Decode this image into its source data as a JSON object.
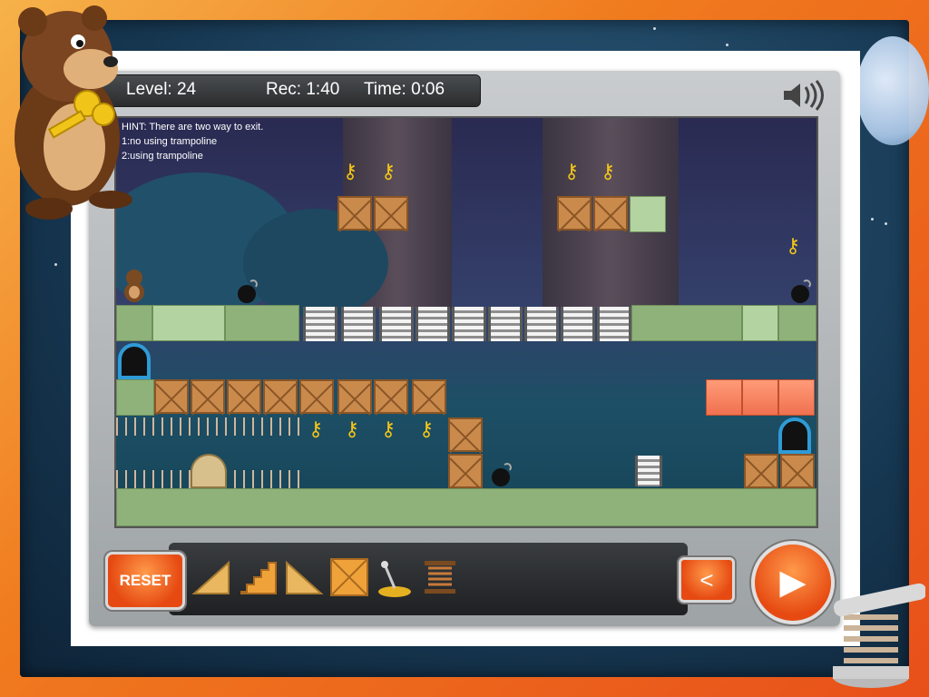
{
  "hud": {
    "level": "Level: 24",
    "record": "Rec: 1:40",
    "time": "Time: 0:06"
  },
  "hint": {
    "line1": "HINT: There are two way to exit.",
    "line2": "1:no using trampoline",
    "line3": "2:using trampoline"
  },
  "toolbar": {
    "reset_label": "RESET",
    "back_glyph": "<",
    "play_glyph": "▶",
    "tools": [
      "triangle-ramp-icon",
      "stairs-ramp-icon",
      "triangle-ramp-reverse-icon",
      "crate-icon",
      "lever-icon",
      "spring-icon"
    ]
  },
  "colors": {
    "accent": "#e64a12",
    "frame": "#f07a1e",
    "key": "#f1c419",
    "door": "#2f9bd6"
  }
}
